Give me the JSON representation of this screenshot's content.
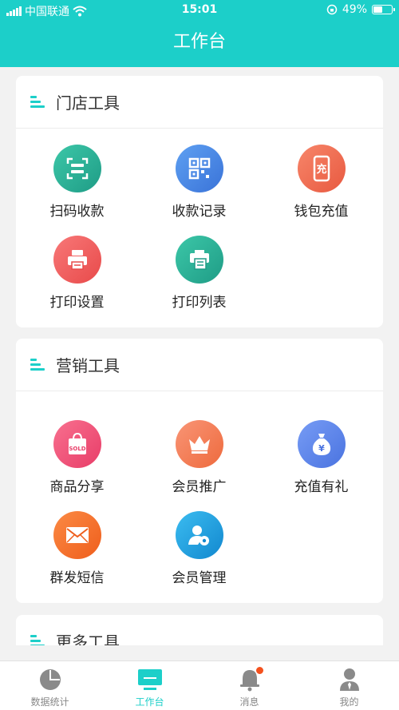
{
  "status_bar": {
    "carrier": "中国联通",
    "time": "15:01",
    "battery": "49%"
  },
  "navbar": {
    "title": "工作台"
  },
  "store_tools": {
    "title": "门店工具",
    "items": [
      {
        "label": "扫码收款",
        "icon": "scan-icon",
        "color": "#27b39a"
      },
      {
        "label": "收款记录",
        "icon": "qrcode-icon",
        "color": "#4a88e8"
      },
      {
        "label": "钱包充值",
        "icon": "phone-recharge-icon",
        "color": "#f06c4f"
      },
      {
        "label": "打印设置",
        "icon": "printer-icon",
        "color": "#f25a5a"
      },
      {
        "label": "打印列表",
        "icon": "print-list-icon",
        "color": "#27b39a"
      }
    ]
  },
  "marketing_tools": {
    "title": "营销工具",
    "items": [
      {
        "label": "商品分享",
        "icon": "shopping-bag-icon",
        "color": "#f0517a",
        "sub": "SOLD"
      },
      {
        "label": "会员推广",
        "icon": "crown-icon",
        "color": "#f57a4a"
      },
      {
        "label": "充值有礼",
        "icon": "money-bag-icon",
        "color": "#5a86ec",
        "sub": "¥"
      },
      {
        "label": "群发短信",
        "icon": "envelope-icon",
        "color": "#f5702e"
      },
      {
        "label": "会员管理",
        "icon": "member-settings-icon",
        "color": "#1ea2e0"
      }
    ]
  },
  "more_tools": {
    "title": "更多工具"
  },
  "tabbar": {
    "items": [
      {
        "label": "数据统计",
        "icon": "pie-chart-icon",
        "active": false
      },
      {
        "label": "工作台",
        "icon": "monitor-icon",
        "active": true
      },
      {
        "label": "消息",
        "icon": "bell-icon",
        "active": false
      },
      {
        "label": "我的",
        "icon": "user-icon",
        "active": false
      }
    ]
  }
}
